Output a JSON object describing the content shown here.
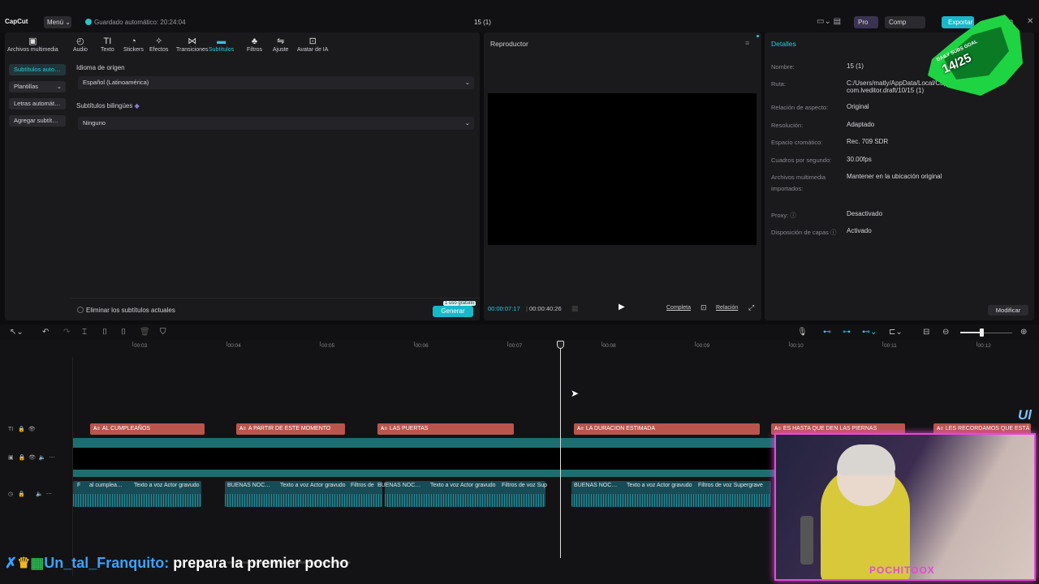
{
  "app": {
    "logo": "CapCut",
    "menu_label": "Menú",
    "autosave": "Guardado automático: 20:24:04",
    "project_title": "15 (1)",
    "pro_label": "Pro",
    "share_label": "Comp",
    "export_label": "Exportar"
  },
  "toolbar": [
    {
      "label": "Archivos multimedia",
      "icon": "media-icon",
      "glyph": "▣"
    },
    {
      "label": "Audio",
      "icon": "audio-icon",
      "glyph": "◴"
    },
    {
      "label": "Texto",
      "icon": "text-icon",
      "glyph": "TI"
    },
    {
      "label": "Stickers",
      "icon": "sticker-icon",
      "glyph": "◔"
    },
    {
      "label": "Efectos",
      "icon": "effects-icon",
      "glyph": "✧"
    },
    {
      "label": "Transiciones",
      "icon": "transitions-icon",
      "glyph": "⋈"
    },
    {
      "label": "Subtítulos",
      "icon": "subtitles-icon",
      "glyph": "▬",
      "active": true
    },
    {
      "label": "Filtros",
      "icon": "filters-icon",
      "glyph": "♣"
    },
    {
      "label": "Ajuste",
      "icon": "adjust-icon",
      "glyph": "⇋"
    },
    {
      "label": "Avatar de IA",
      "icon": "ai-avatar-icon",
      "glyph": "⊡"
    }
  ],
  "sidebar": [
    {
      "label": "Subtítulos auto…",
      "active": true
    },
    {
      "label": "Plantillas"
    },
    {
      "label": "Letras automát…"
    },
    {
      "label": "Agregar subtít…"
    }
  ],
  "form": {
    "source_lang_label": "Idioma de origen",
    "source_lang_value": "Español (Latinoamérica)",
    "bilingual_label": "Subtítulos bilingües",
    "bilingual_value": "Ninguno",
    "remove_current": "Eliminar los subtítulos actuales",
    "generate": "Generar",
    "free_use": "1 uso gratuito"
  },
  "player": {
    "title": "Reproductor",
    "time_current": "00:00:07:17",
    "time_total": "00:00:40:26",
    "full_label": "Completa",
    "ratio_label": "Relación"
  },
  "details": {
    "title": "Detalles",
    "rows": [
      {
        "k": "Nombre:",
        "v": "15 (1)"
      },
      {
        "k": "Ruta:",
        "v": "C:/Users/matly/AppData/Local/CapCut/User",
        "v2": "com.lveditor.draft/10/15 (1)"
      },
      {
        "k": "Relación de aspecto:",
        "v": "Original"
      },
      {
        "k": "Resolución:",
        "v": "Adaptado"
      },
      {
        "k": "Espacio cromático:",
        "v": "Rec. 709 SDR"
      },
      {
        "k": "Cuadros por segundo:",
        "v": "30.00fps"
      },
      {
        "k": "Archivos multimedia",
        "k2": "importados:",
        "v": "Mantener en la ubicación original"
      },
      {
        "k": "Proxy: ⓘ",
        "v": "Desactivado"
      },
      {
        "k": "Disposición de capas ⓘ",
        "v": "Activado"
      }
    ],
    "modify": "Modificar"
  },
  "timeline": {
    "ticks": [
      "00:03",
      "00:04",
      "00:05",
      "00:06",
      "00:07",
      "00:08",
      "00:09",
      "00:10",
      "00:11",
      "00:12"
    ],
    "subtitle_clips": [
      "AL CUMPLEAÑOS",
      "A PARTIR DE ESTE MOMENTO",
      "LAS PUERTAS",
      "LA DURACION ESTIMADA",
      "ES HASTA QUE DEN LAS PIERNAS",
      "LES RECORDAMOS QUE ESTÁ TE"
    ],
    "audio_labels": [
      "F",
      "al cumplea…",
      "Texto a voz Actor gravudo",
      "BUENAS NOC…",
      "Texto a voz Actor gravudo",
      "Filtros de",
      "BUENAS NOC…",
      "Texto a voz Actor gravudo",
      "Filtros de voz Sup",
      "BUENAS NOC…",
      "Texto a voz Actor gravudo",
      "Filtros de voz Supergrave"
    ]
  },
  "overlay": {
    "chat_user": "Un_tal_Franquito:",
    "chat_msg": "prepara la premier pocho",
    "badge": "14/25",
    "badge_sub": "DAILY SUBS GOAL",
    "cam_name": "POCHITOOX",
    "side_text": "Ul"
  }
}
